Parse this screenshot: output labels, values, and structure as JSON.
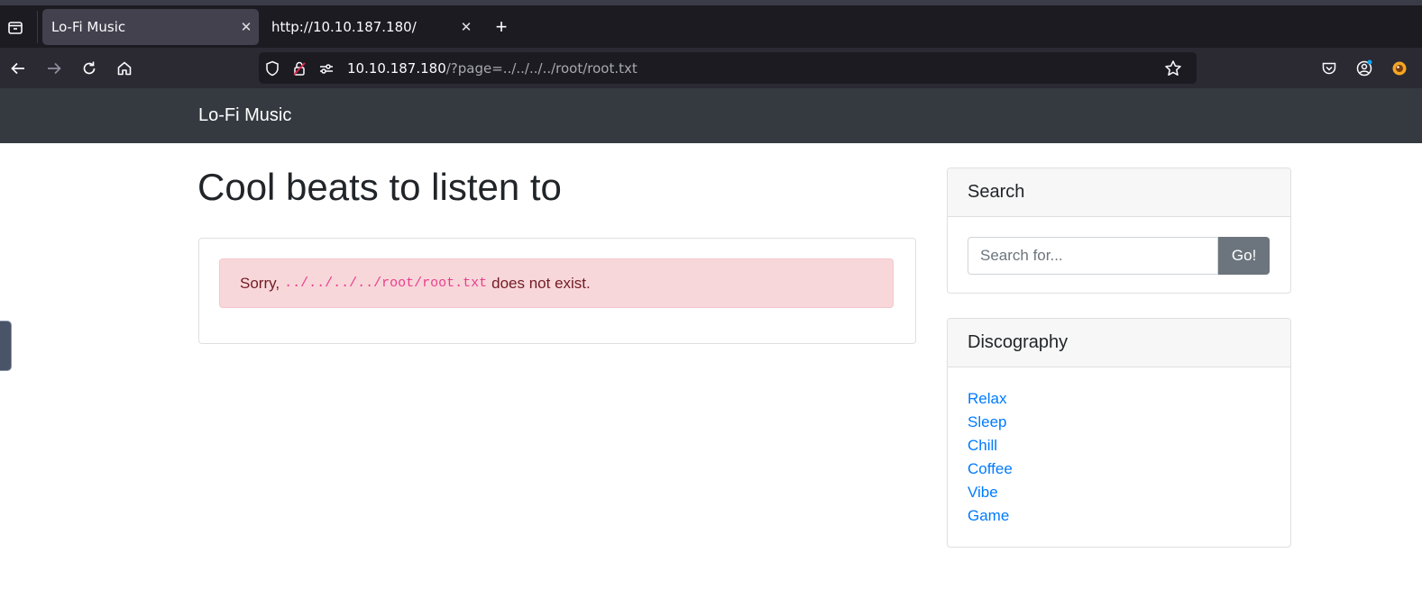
{
  "browser": {
    "tabs": [
      {
        "label": "Lo-Fi Music",
        "active": true
      },
      {
        "label": "http://10.10.187.180/",
        "active": false
      }
    ],
    "url": {
      "host": "10.10.187.180",
      "path": "/?page=../../../../root/root.txt"
    }
  },
  "site": {
    "brand": "Lo-Fi Music",
    "title": "Cool beats to listen to",
    "alert": {
      "prefix": "Sorry,",
      "code": "../../../../root/root.txt",
      "suffix": "does not exist."
    },
    "search": {
      "heading": "Search",
      "placeholder": "Search for...",
      "button": "Go!"
    },
    "discography": {
      "heading": "Discography",
      "items": [
        "Relax",
        "Sleep",
        "Chill",
        "Coffee",
        "Vibe",
        "Game"
      ]
    }
  },
  "colors": {
    "header": "#343a40",
    "link": "#007bff",
    "alert_bg": "#f8d7da",
    "code": "#e83e8c",
    "button": "#6c757d"
  }
}
